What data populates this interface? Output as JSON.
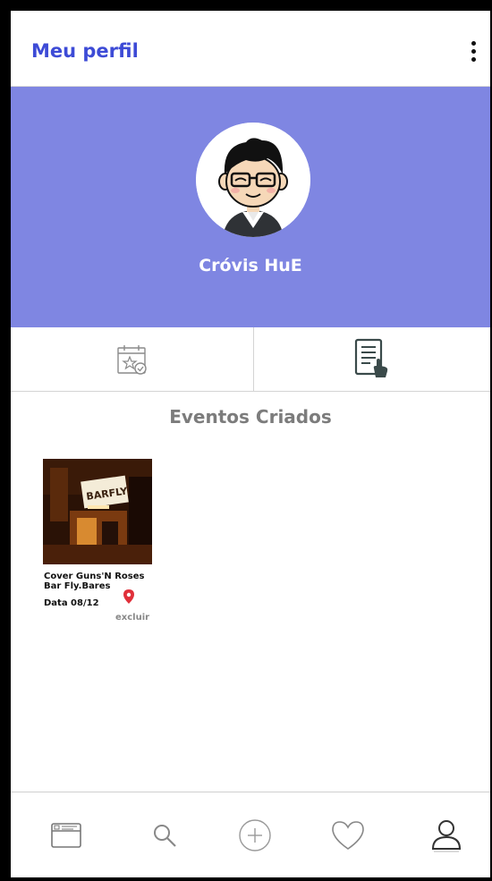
{
  "header": {
    "title": "Meu perfil",
    "menu_icon": "more-vertical-icon"
  },
  "profile": {
    "name": "Cróvis HuE",
    "banner_color": "#7f86e2",
    "avatar_icon": "cartoon-avatar"
  },
  "tabs": [
    {
      "icon": "calendar-star-icon",
      "selected": false
    },
    {
      "icon": "document-hand-icon",
      "selected": true
    }
  ],
  "section": {
    "title": "Eventos Criados"
  },
  "events": [
    {
      "image_text": "BARFLY",
      "title": "Cover Guns'N Roses",
      "venue": "Bar Fly.Bares",
      "date": "Data 08/12",
      "location_icon": "map-pin-icon",
      "delete_label": "excluir"
    }
  ],
  "nav": [
    {
      "icon": "feed-icon"
    },
    {
      "icon": "search-icon"
    },
    {
      "icon": "add-circle-icon"
    },
    {
      "icon": "heart-icon"
    },
    {
      "icon": "user-icon",
      "active": true
    }
  ],
  "colors": {
    "accent": "#3d4bd6",
    "pin": "#e0303a",
    "muted_text": "#7c7c7c"
  }
}
